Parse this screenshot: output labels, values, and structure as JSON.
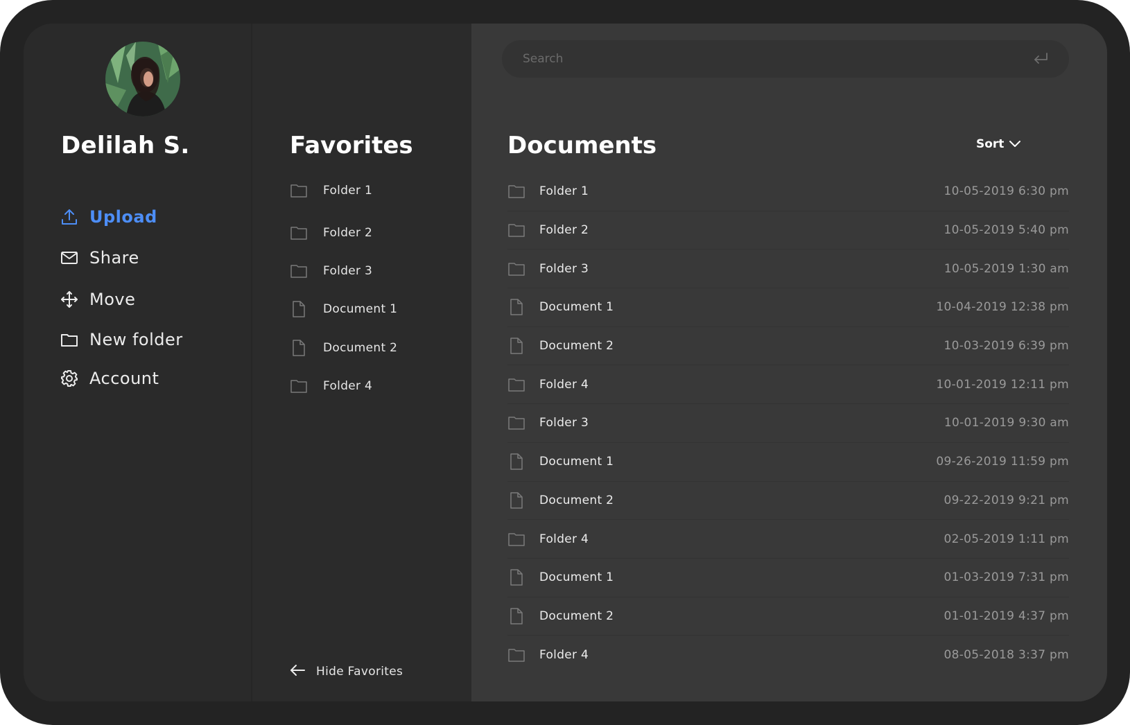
{
  "user": {
    "name": "Delilah S."
  },
  "nav": {
    "items": [
      {
        "label": "Upload",
        "icon": "upload-icon",
        "active": true
      },
      {
        "label": "Share",
        "icon": "mail-icon",
        "active": false
      },
      {
        "label": "Move",
        "icon": "move-icon",
        "active": false
      },
      {
        "label": "New folder",
        "icon": "folder-icon",
        "active": false
      },
      {
        "label": "Account",
        "icon": "gear-icon",
        "active": false
      }
    ]
  },
  "favorites": {
    "title": "Favorites",
    "items": [
      {
        "label": "Folder 1",
        "type": "folder"
      },
      {
        "label": "Folder 2",
        "type": "folder"
      },
      {
        "label": "Folder 3",
        "type": "folder"
      },
      {
        "label": "Document 1",
        "type": "document"
      },
      {
        "label": "Document 2",
        "type": "document"
      },
      {
        "label": "Folder 4",
        "type": "folder"
      }
    ],
    "hide_label": "Hide Favorites"
  },
  "documents": {
    "search_placeholder": "Search",
    "title": "Documents",
    "sort_label": "Sort",
    "rows": [
      {
        "name": "Folder 1",
        "type": "folder",
        "date": "10-05-2019 6:30 pm"
      },
      {
        "name": "Folder 2",
        "type": "folder",
        "date": "10-05-2019 5:40 pm"
      },
      {
        "name": "Folder 3",
        "type": "folder",
        "date": "10-05-2019 1:30 am"
      },
      {
        "name": "Document 1",
        "type": "document",
        "date": "10-04-2019 12:38 pm"
      },
      {
        "name": "Document 2",
        "type": "document",
        "date": "10-03-2019 6:39 pm"
      },
      {
        "name": "Folder 4",
        "type": "folder",
        "date": "10-01-2019 12:11 pm"
      },
      {
        "name": "Folder 3",
        "type": "folder",
        "date": "10-01-2019 9:30 am"
      },
      {
        "name": "Document 1",
        "type": "document",
        "date": "09-26-2019 11:59 pm"
      },
      {
        "name": "Document 2",
        "type": "document",
        "date": "09-22-2019 9:21 pm"
      },
      {
        "name": "Folder 4",
        "type": "folder",
        "date": "02-05-2019 1:11 pm"
      },
      {
        "name": "Document 1",
        "type": "document",
        "date": "01-03-2019 7:31 pm"
      },
      {
        "name": "Document 2",
        "type": "document",
        "date": "01-01-2019 4:37 pm"
      },
      {
        "name": "Folder 4",
        "type": "folder",
        "date": "08-05-2018 3:37 pm"
      }
    ]
  },
  "colors": {
    "accent": "#4d8ef7",
    "frame": "#232323",
    "sidebar_bg": "#2a2a2a",
    "documents_bg": "#393939",
    "icon_muted": "#7a7a7a"
  }
}
